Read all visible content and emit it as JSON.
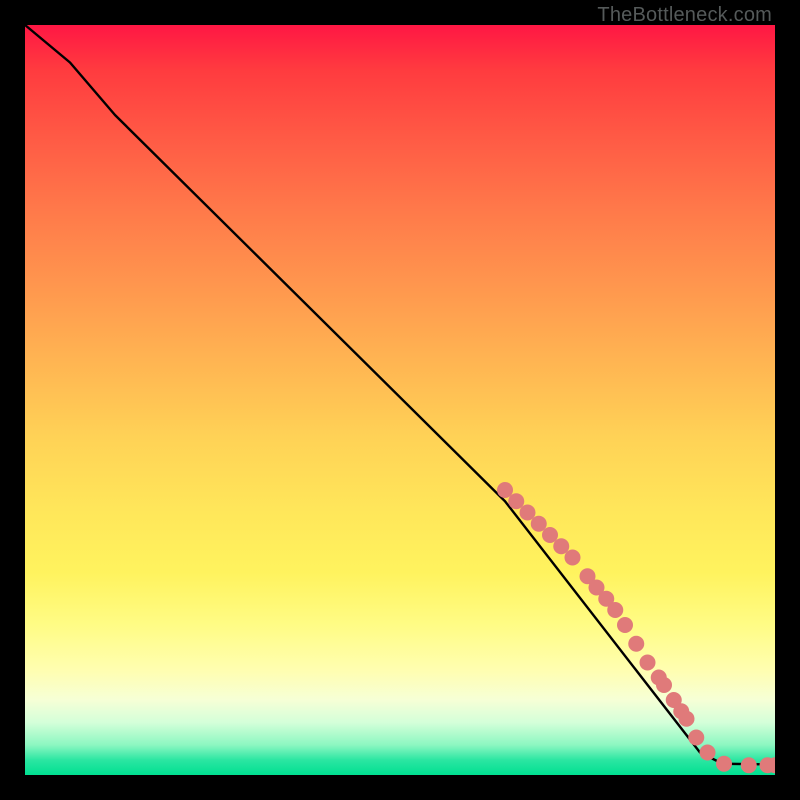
{
  "watermark": "TheBottleneck.com",
  "colors": {
    "marker": "#e07a7a",
    "marker_stroke": "#c95c5c",
    "line": "#000000"
  },
  "chart_data": {
    "type": "line",
    "title": "",
    "xlabel": "",
    "ylabel": "",
    "xlim": [
      0,
      100
    ],
    "ylim": [
      0,
      100
    ],
    "grid": false,
    "line_points": [
      {
        "x": 0,
        "y": 100
      },
      {
        "x": 6,
        "y": 95
      },
      {
        "x": 12,
        "y": 88
      },
      {
        "x": 64,
        "y": 36.5
      },
      {
        "x": 90,
        "y": 3
      },
      {
        "x": 93,
        "y": 1.5
      },
      {
        "x": 100,
        "y": 1.4
      }
    ],
    "markers": [
      {
        "x": 64.0,
        "y": 38.0
      },
      {
        "x": 65.5,
        "y": 36.5
      },
      {
        "x": 67.0,
        "y": 35.0
      },
      {
        "x": 68.5,
        "y": 33.5
      },
      {
        "x": 70.0,
        "y": 32.0
      },
      {
        "x": 71.5,
        "y": 30.5
      },
      {
        "x": 73.0,
        "y": 29.0
      },
      {
        "x": 75.0,
        "y": 26.5
      },
      {
        "x": 76.2,
        "y": 25.0
      },
      {
        "x": 77.5,
        "y": 23.5
      },
      {
        "x": 78.7,
        "y": 22.0
      },
      {
        "x": 80.0,
        "y": 20.0
      },
      {
        "x": 81.5,
        "y": 17.5
      },
      {
        "x": 83.0,
        "y": 15.0
      },
      {
        "x": 84.5,
        "y": 13.0
      },
      {
        "x": 85.2,
        "y": 12.0
      },
      {
        "x": 86.5,
        "y": 10.0
      },
      {
        "x": 87.5,
        "y": 8.5
      },
      {
        "x": 88.2,
        "y": 7.5
      },
      {
        "x": 89.5,
        "y": 5.0
      },
      {
        "x": 91.0,
        "y": 3.0
      },
      {
        "x": 93.2,
        "y": 1.5
      },
      {
        "x": 96.5,
        "y": 1.3
      },
      {
        "x": 99.0,
        "y": 1.3
      },
      {
        "x": 100.0,
        "y": 1.3
      }
    ]
  }
}
